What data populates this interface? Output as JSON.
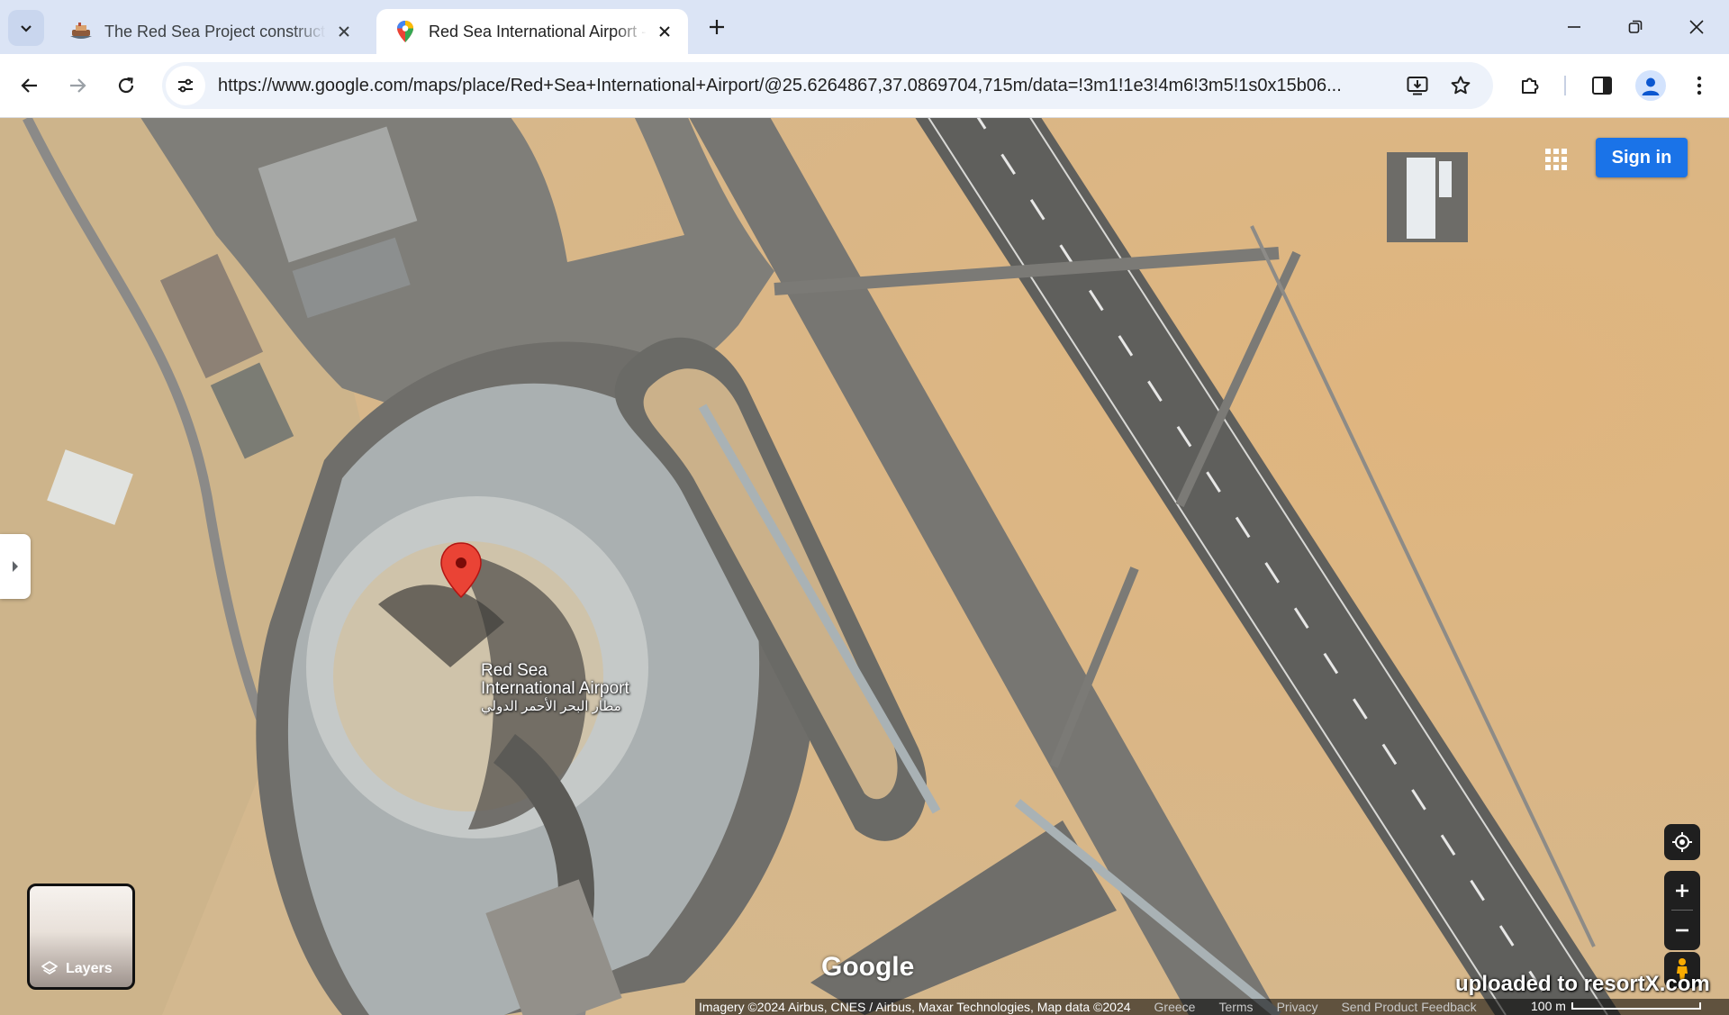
{
  "browser": {
    "tabs": [
      {
        "title": "The Red Sea Project construction",
        "active": false
      },
      {
        "title": "Red Sea International Airport - Google Maps",
        "active": true
      }
    ],
    "url": "https://www.google.com/maps/place/Red+Sea+International+Airport/@25.6264867,37.0869704,715m/data=!3m1!1e3!4m6!3m5!1s0x15b06..."
  },
  "map": {
    "signin_label": "Sign in",
    "place": {
      "name_line1": "Red Sea",
      "name_line2": "International Airport",
      "name_arabic": "مطار البحر الأحمر الدولي"
    },
    "layers_label": "Layers",
    "google_logo": "Google",
    "watermark": "uploaded to resortX.com",
    "attribution": {
      "imagery": "Imagery ©2024 Airbus, CNES / Airbus, Maxar Technologies, Map data ©2024",
      "region": "Greece",
      "terms": "Terms",
      "privacy": "Privacy",
      "feedback": "Send Product Feedback",
      "scale": "100 m"
    },
    "colors": {
      "pin": "#ea4335",
      "signin": "#1a73e8"
    }
  }
}
